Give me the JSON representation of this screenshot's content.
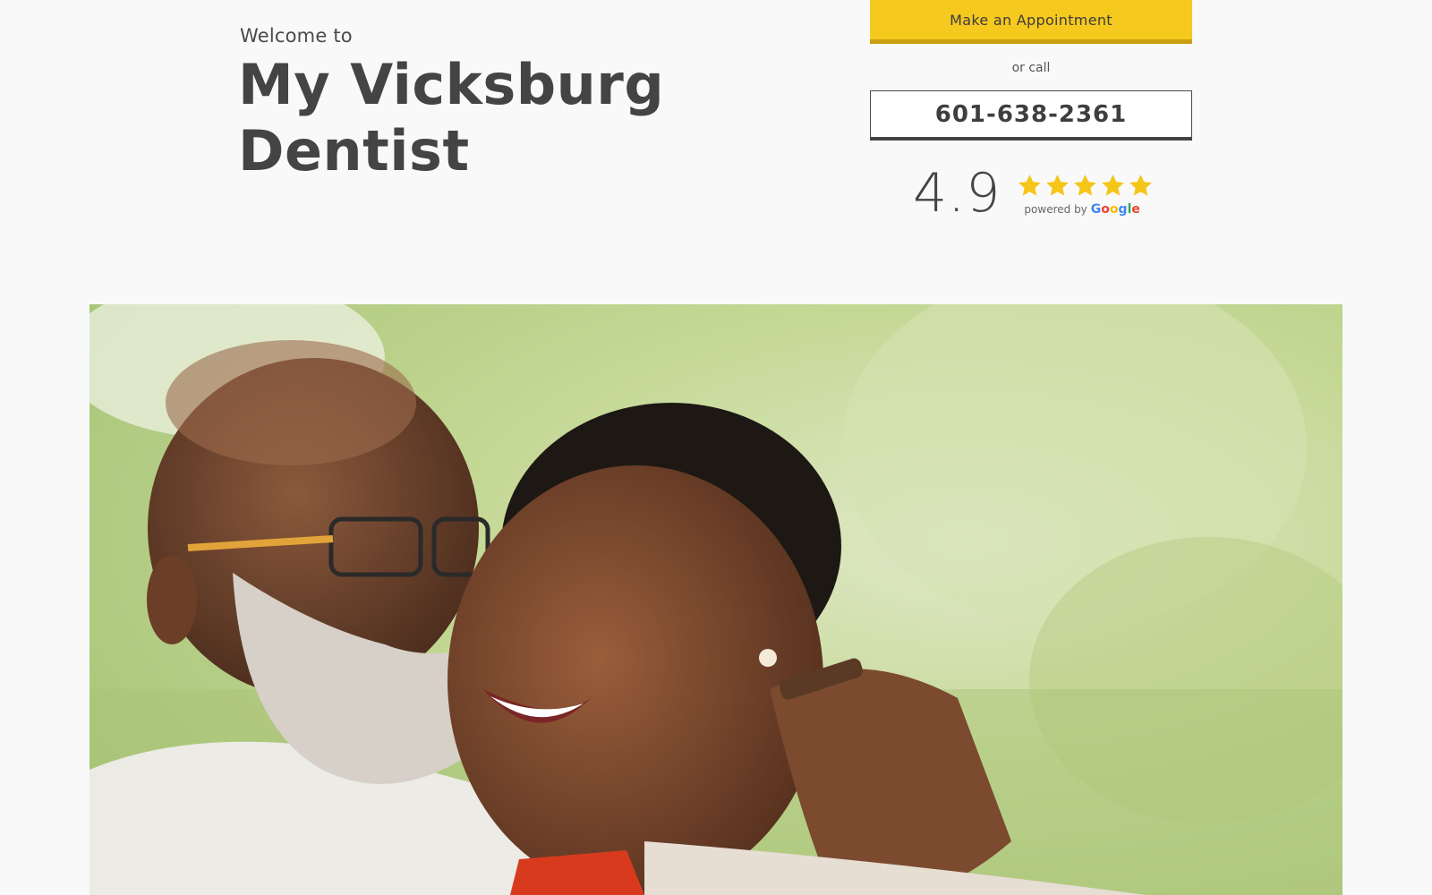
{
  "header": {
    "welcome": "Welcome to",
    "title_line1": "My Vicksburg",
    "title_line2": "Dentist"
  },
  "cta": {
    "appointment_label": "Make an Appointment",
    "or_call": "or call",
    "phone": "601-638-2361"
  },
  "rating": {
    "score": "4.9",
    "stars": 5,
    "powered_by": "powered by",
    "provider": "Google"
  },
  "colors": {
    "accent": "#f6c91f",
    "text": "#444444",
    "star": "#f5c518"
  },
  "hero": {
    "image_icon": "couple-photo"
  }
}
